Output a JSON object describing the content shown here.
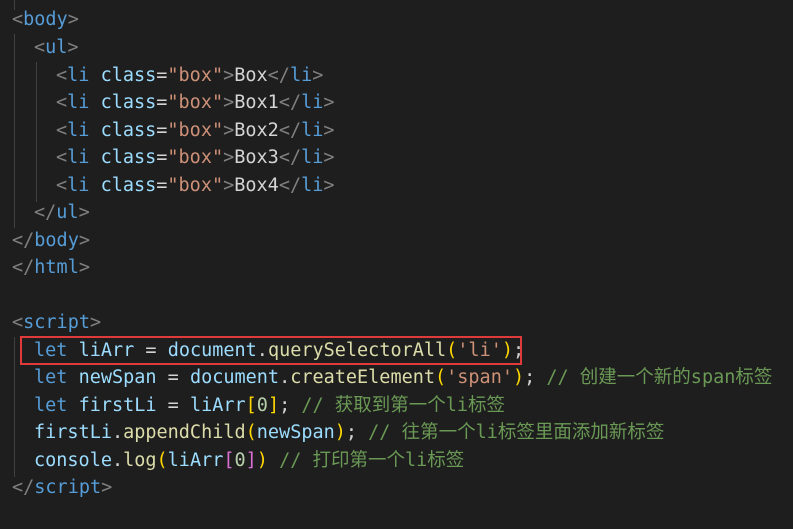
{
  "editor": {
    "colors": {
      "background": "#1e1e1e",
      "tag": "#569cd6",
      "punctuation": "#808080",
      "attribute": "#9cdcfe",
      "string": "#ce9178",
      "function": "#dcdcaa",
      "number": "#b5cea8",
      "comment": "#6a9955",
      "highlight_border": "#e03a3a"
    },
    "code": {
      "body_tag": "body",
      "ul_tag": "ul",
      "li_tag": "li",
      "class_attr": "class",
      "box_class": "\"box\"",
      "items": [
        "Box",
        "Box1",
        "Box2",
        "Box3",
        "Box4"
      ],
      "html_tag": "html",
      "script_tag": "script",
      "kw_let": "let",
      "var_liArr": "liArr",
      "var_newSpan": "newSpan",
      "var_firstLi": "firstLi",
      "obj_document": "document",
      "obj_console": "console",
      "fn_querySelectorAll": "querySelectorAll",
      "fn_createElement": "createElement",
      "fn_appendChild": "appendChild",
      "fn_log": "log",
      "str_li": "'li'",
      "str_span": "'span'",
      "num_zero": "0",
      "comment_create": "// 创建一个新的span标签",
      "comment_get_first": "// 获取到第一个li标签",
      "comment_append": "// 往第一个li标签里面添加新标签",
      "comment_print": "// 打印第一个li标签"
    }
  }
}
